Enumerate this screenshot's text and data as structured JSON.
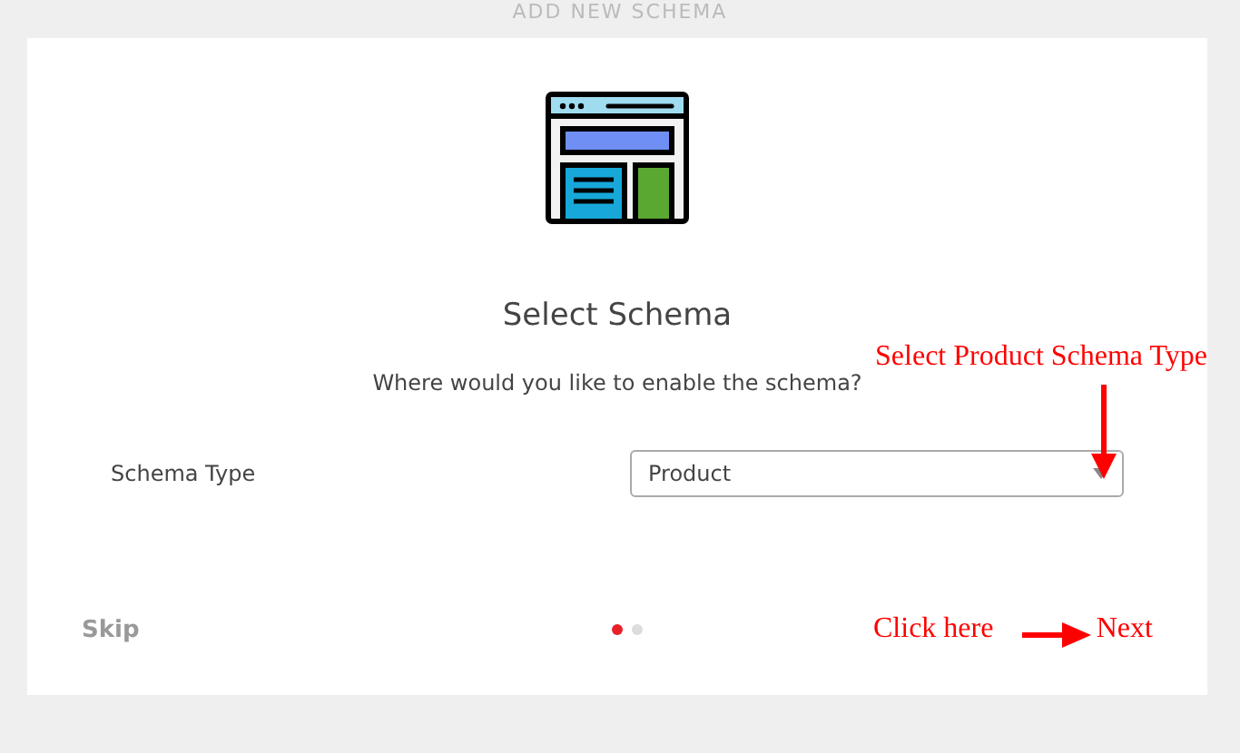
{
  "header": {
    "title": "ADD NEW SCHEMA"
  },
  "card": {
    "title": "Select Schema",
    "subtitle": "Where would you like to enable the schema?",
    "field": {
      "label": "Schema Type",
      "value": "Product"
    },
    "footer": {
      "skip": "Skip",
      "next": "Next",
      "steps": [
        {
          "selected": true
        },
        {
          "selected": false
        }
      ]
    }
  },
  "annotations": [
    {
      "kind": "down",
      "text": "Select Product Schema Type"
    },
    {
      "kind": "right",
      "text": "Click here"
    }
  ]
}
